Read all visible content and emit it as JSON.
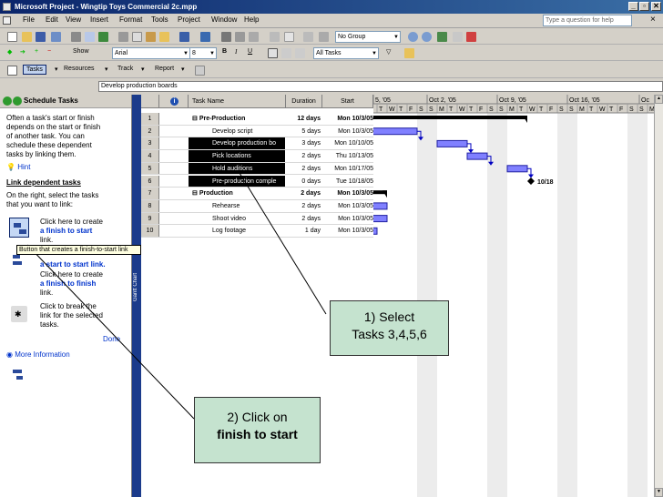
{
  "window": {
    "title": "Microsoft Project - Wingtip Toys Commercial 2c.mpp",
    "minimize": "_",
    "restore": "▫",
    "close": "✕"
  },
  "menu": {
    "items": [
      "File",
      "Edit",
      "View",
      "Insert",
      "Format",
      "Tools",
      "Project",
      "Window",
      "Help"
    ],
    "ask_placeholder": "Type a question for help",
    "close": "×"
  },
  "toolbar1": {
    "group_value": "No Group"
  },
  "toolbar2": {
    "show_label": "Show",
    "font_value": "Arial",
    "size_value": "8",
    "filter_value": "All Tasks"
  },
  "toolbar3": {
    "tasks": "Tasks",
    "resources": "Resources",
    "track": "Track",
    "report": "Report"
  },
  "entry_bar": {
    "value": "Develop production boards"
  },
  "task_pane": {
    "title": "Schedule Tasks",
    "intro": [
      "Often a task's start or finish",
      "depends on the start or finish",
      "of another task. You can",
      "schedule these dependent",
      "tasks by linking them."
    ],
    "hint": "Hint",
    "section": "Link dependent tasks",
    "desc": [
      "On the right, select the tasks",
      "that you want to link:"
    ],
    "opt1_a": "Click here to create",
    "opt1_b": "a finish to start",
    "opt1_c": "link.",
    "opt2_b": "a start to start link.",
    "opt3_a": "Click here to create",
    "opt3_b": "a finish to finish",
    "opt3_c": "link.",
    "opt4": [
      "Click to break the",
      "link for the selected",
      "tasks."
    ],
    "done": "Done",
    "more_info": "More Information",
    "tooltip": "Button that creates a finish-to-start link"
  },
  "gantt_label": "Gantt Chart",
  "columns": {
    "info": "i",
    "name": "Task Name",
    "duration": "Duration",
    "start": "Start"
  },
  "tasks": [
    {
      "id": "1",
      "name": "Pre-Production",
      "duration": "12 days",
      "start": "Mon 10/3/05",
      "summary": true,
      "selected": false
    },
    {
      "id": "2",
      "name": "Develop script",
      "duration": "5 days",
      "start": "Mon 10/3/05",
      "summary": false,
      "selected": false
    },
    {
      "id": "3",
      "name": "Develop production bo",
      "duration": "3 days",
      "start": "Mon 10/10/05",
      "summary": false,
      "selected": true
    },
    {
      "id": "4",
      "name": "Pick locations",
      "duration": "2 days",
      "start": "Thu 10/13/05",
      "summary": false,
      "selected": true
    },
    {
      "id": "5",
      "name": "Hold auditions",
      "duration": "2 days",
      "start": "Mon 10/17/05",
      "summary": false,
      "selected": true
    },
    {
      "id": "6",
      "name": "Pre-production comple",
      "duration": "0 days",
      "start": "Tue 10/18/05",
      "summary": false,
      "selected": true
    },
    {
      "id": "7",
      "name": "Production",
      "duration": "2 days",
      "start": "Mon 10/3/05",
      "summary": true,
      "selected": false
    },
    {
      "id": "8",
      "name": "Rehearse",
      "duration": "2 days",
      "start": "Mon 10/3/05",
      "summary": false,
      "selected": false
    },
    {
      "id": "9",
      "name": "Shoot video",
      "duration": "2 days",
      "start": "Mon 10/3/05",
      "summary": false,
      "selected": false
    },
    {
      "id": "10",
      "name": "Log footage",
      "duration": "1 day",
      "start": "Mon 10/3/05",
      "summary": false,
      "selected": false
    }
  ],
  "timescale": {
    "weeks": [
      "5, '05",
      "Oct 2, '05",
      "Oct 9, '05",
      "Oct 16, '05",
      "Oc"
    ],
    "days": "T W T F S S M T W T F S S M T W T F S S M T W T F S S M",
    "milestone_label": "10/18"
  },
  "callouts": {
    "c1": [
      "1) Select",
      "Tasks 3,4,5,6"
    ],
    "c2": [
      "2) Click on",
      "finish to start"
    ]
  },
  "colors": {
    "title_bar": "#0a246a",
    "gantt_bar": "#8080ff",
    "callout": "#c5e3cf",
    "selection": "#000000"
  }
}
